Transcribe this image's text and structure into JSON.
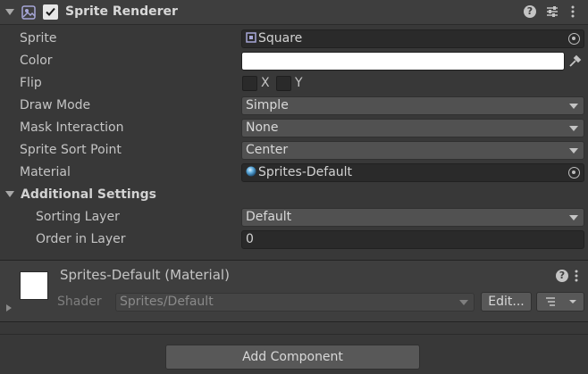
{
  "component": {
    "title": "Sprite Renderer",
    "enabled": true,
    "icons": [
      "help-icon",
      "presets-icon",
      "kebab-menu-icon"
    ]
  },
  "properties": {
    "sprite": {
      "label": "Sprite",
      "value": "Square"
    },
    "color": {
      "label": "Color",
      "value": "#ffffff"
    },
    "flip": {
      "label": "Flip",
      "x_label": "X",
      "y_label": "Y",
      "x_checked": false,
      "y_checked": false
    },
    "draw_mode": {
      "label": "Draw Mode",
      "value": "Simple"
    },
    "mask_interaction": {
      "label": "Mask Interaction",
      "value": "None"
    },
    "sprite_sort_point": {
      "label": "Sprite Sort Point",
      "value": "Center"
    },
    "material": {
      "label": "Material",
      "value": "Sprites-Default"
    }
  },
  "additional_settings": {
    "title": "Additional Settings",
    "sorting_layer": {
      "label": "Sorting Layer",
      "value": "Default"
    },
    "order_in_layer": {
      "label": "Order in Layer",
      "value": "0"
    }
  },
  "material_section": {
    "title": "Sprites-Default (Material)",
    "shader_label": "Shader",
    "shader_value": "Sprites/Default",
    "edit_label": "Edit..."
  },
  "add_component": {
    "label": "Add Component"
  },
  "colors": {
    "background": "#383838",
    "field": "#2a2a2a",
    "dropdown": "#515151",
    "text": "#c4c4c4"
  }
}
